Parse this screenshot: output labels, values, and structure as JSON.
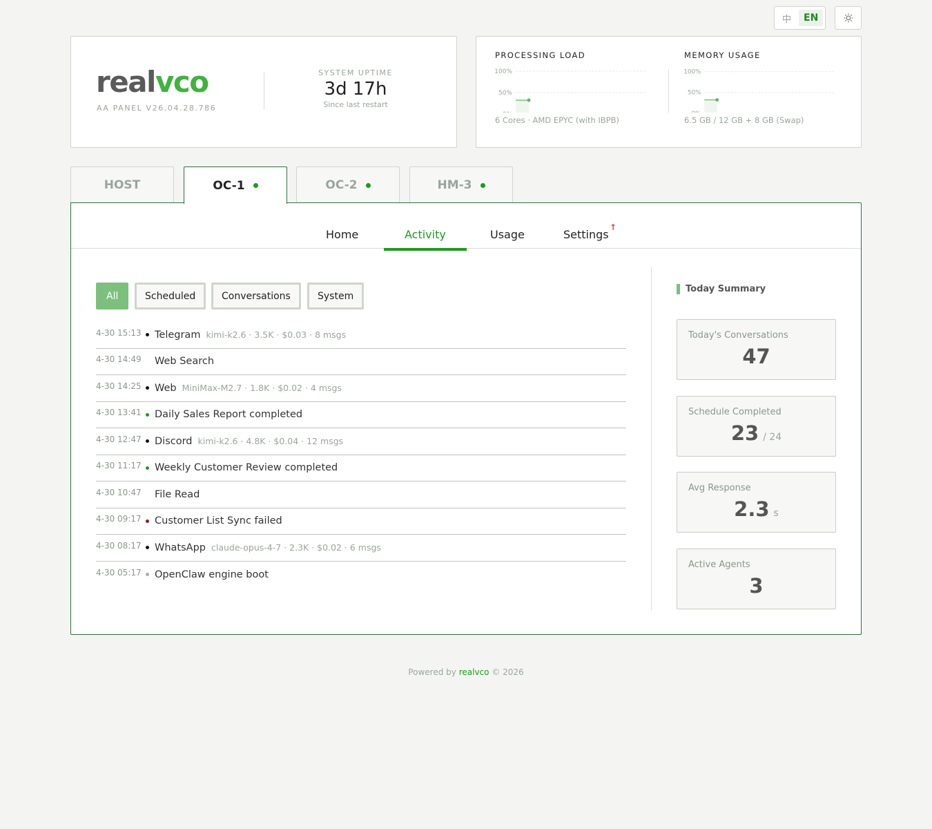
{
  "topbar": {
    "lang_zh": "中",
    "lang_en": "EN",
    "theme_icon": "sun-icon"
  },
  "brand": {
    "logo_part1": "real",
    "logo_part2": "vco",
    "version": "AA PANEL  V26.04.28.786",
    "uptime_label": "SYSTEM UPTIME",
    "uptime_value": "3d 17h",
    "uptime_sub": "Since last restart"
  },
  "metrics": {
    "processing": {
      "title": "PROCESSING LOAD",
      "sub": "6 Cores · AMD EPYC (with IBPB)",
      "ticks": [
        "100%",
        "50%",
        "0%"
      ],
      "level": 0.33
    },
    "memory": {
      "title": "MEMORY USAGE",
      "sub": "6.5 GB / 12 GB + 8 GB (Swap)",
      "ticks": [
        "100%",
        "50%",
        "0%"
      ],
      "level": 0.33
    }
  },
  "server_tabs": [
    {
      "label": "HOST",
      "online": false
    },
    {
      "label": "OC-1",
      "online": true
    },
    {
      "label": "OC-2",
      "online": true
    },
    {
      "label": "HM-3",
      "online": true
    }
  ],
  "nav": {
    "home": "Home",
    "activity": "Activity",
    "usage": "Usage",
    "settings": "Settings",
    "settings_badge": "↑"
  },
  "filters": [
    "All",
    "Scheduled",
    "Conversations",
    "System"
  ],
  "activity": [
    {
      "time": "4-30 15:13",
      "dot": "black",
      "title": "Telegram",
      "meta": "kimi-k2.6 · 3.5K · $0.03 · 8 msgs"
    },
    {
      "time": "4-30 14:49",
      "dot": "none",
      "title": "Web Search",
      "meta": ""
    },
    {
      "time": "4-30 14:25",
      "dot": "black",
      "title": "Web",
      "meta": "MiniMax-M2.7 · 1.8K · $0.02 · 4 msgs"
    },
    {
      "time": "4-30 13:41",
      "dot": "green",
      "title": "Daily Sales Report completed",
      "meta": ""
    },
    {
      "time": "4-30 12:47",
      "dot": "black",
      "title": "Discord",
      "meta": "kimi-k2.6 · 4.8K · $0.04 · 12 msgs"
    },
    {
      "time": "4-30 11:17",
      "dot": "green",
      "title": "Weekly Customer Review completed",
      "meta": ""
    },
    {
      "time": "4-30 10:47",
      "dot": "none",
      "title": "File Read",
      "meta": ""
    },
    {
      "time": "4-30 09:17",
      "dot": "red",
      "title": "Customer List Sync failed",
      "meta": ""
    },
    {
      "time": "4-30 08:17",
      "dot": "black",
      "title": "WhatsApp",
      "meta": "claude-opus-4-7 · 2.3K · $0.02 · 6 msgs"
    },
    {
      "time": "4-30 05:17",
      "dot": "grey",
      "title": "OpenClaw engine boot",
      "meta": ""
    }
  ],
  "summary": {
    "heading": "Today Summary",
    "conversations_label": "Today's Conversations",
    "conversations_value": "47",
    "schedule_label": "Schedule Completed",
    "schedule_value": "23",
    "schedule_total": "/ 24",
    "avg_label": "Avg Response",
    "avg_value": "2.3",
    "avg_unit": "s",
    "agents_label": "Active Agents",
    "agents_value": "3"
  },
  "footer": {
    "prefix": "Powered by",
    "brand": "realvco",
    "suffix": "© 2026"
  }
}
